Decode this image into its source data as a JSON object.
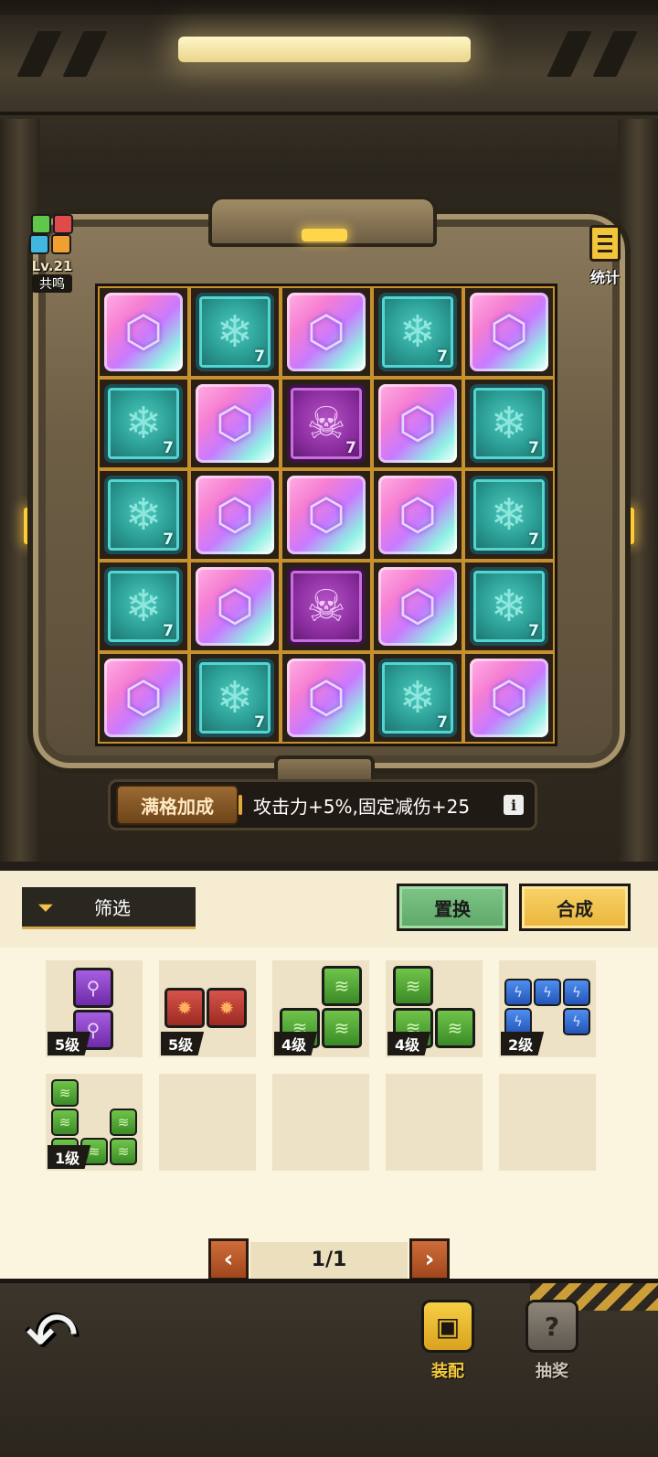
{
  "resonance": {
    "level": "Lv.21",
    "label": "共鸣"
  },
  "stats": {
    "label": "统计",
    "icon": "clipboard-icon"
  },
  "board": {
    "rows": [
      [
        {
          "type": "gem"
        },
        {
          "type": "snow",
          "level": "7"
        },
        {
          "type": "gem"
        },
        {
          "type": "snow",
          "level": "7"
        },
        {
          "type": "gem"
        }
      ],
      [
        {
          "type": "snow",
          "level": "7"
        },
        {
          "type": "gem"
        },
        {
          "type": "skull",
          "level": "7"
        },
        {
          "type": "gem"
        },
        {
          "type": "snow",
          "level": "7"
        }
      ],
      [
        {
          "type": "snow",
          "level": "7"
        },
        {
          "type": "gem"
        },
        {
          "type": "gem"
        },
        {
          "type": "gem"
        },
        {
          "type": "snow",
          "level": "7"
        }
      ],
      [
        {
          "type": "snow",
          "level": "7"
        },
        {
          "type": "gem"
        },
        {
          "type": "skull"
        },
        {
          "type": "gem"
        },
        {
          "type": "snow",
          "level": "7"
        }
      ],
      [
        {
          "type": "gem"
        },
        {
          "type": "snow",
          "level": "7"
        },
        {
          "type": "gem"
        },
        {
          "type": "snow",
          "level": "7"
        },
        {
          "type": "gem"
        }
      ]
    ]
  },
  "bonus": {
    "title": "满格加成",
    "text": "攻击力+5%,固定减伤+25",
    "info_icon": "i"
  },
  "toolbar": {
    "filter_label": "筛选",
    "swap_label": "置换",
    "merge_label": "合成"
  },
  "inventory": [
    {
      "level": "5级",
      "color": "purple"
    },
    {
      "level": "5级",
      "color": "red"
    },
    {
      "level": "4级",
      "color": "green"
    },
    {
      "level": "4级",
      "color": "green"
    },
    {
      "level": "2级",
      "color": "blue"
    },
    {
      "level": "1级",
      "color": "green"
    }
  ],
  "pager": {
    "text": "1/1",
    "prev": "‹",
    "next": "›"
  },
  "nav": {
    "equip_label": "装配",
    "lottery_label": "抽奖"
  },
  "colors": {
    "accent": "#f5c93e",
    "gold_border": "#c7902e",
    "panel_bg": "#f6ecd2"
  }
}
